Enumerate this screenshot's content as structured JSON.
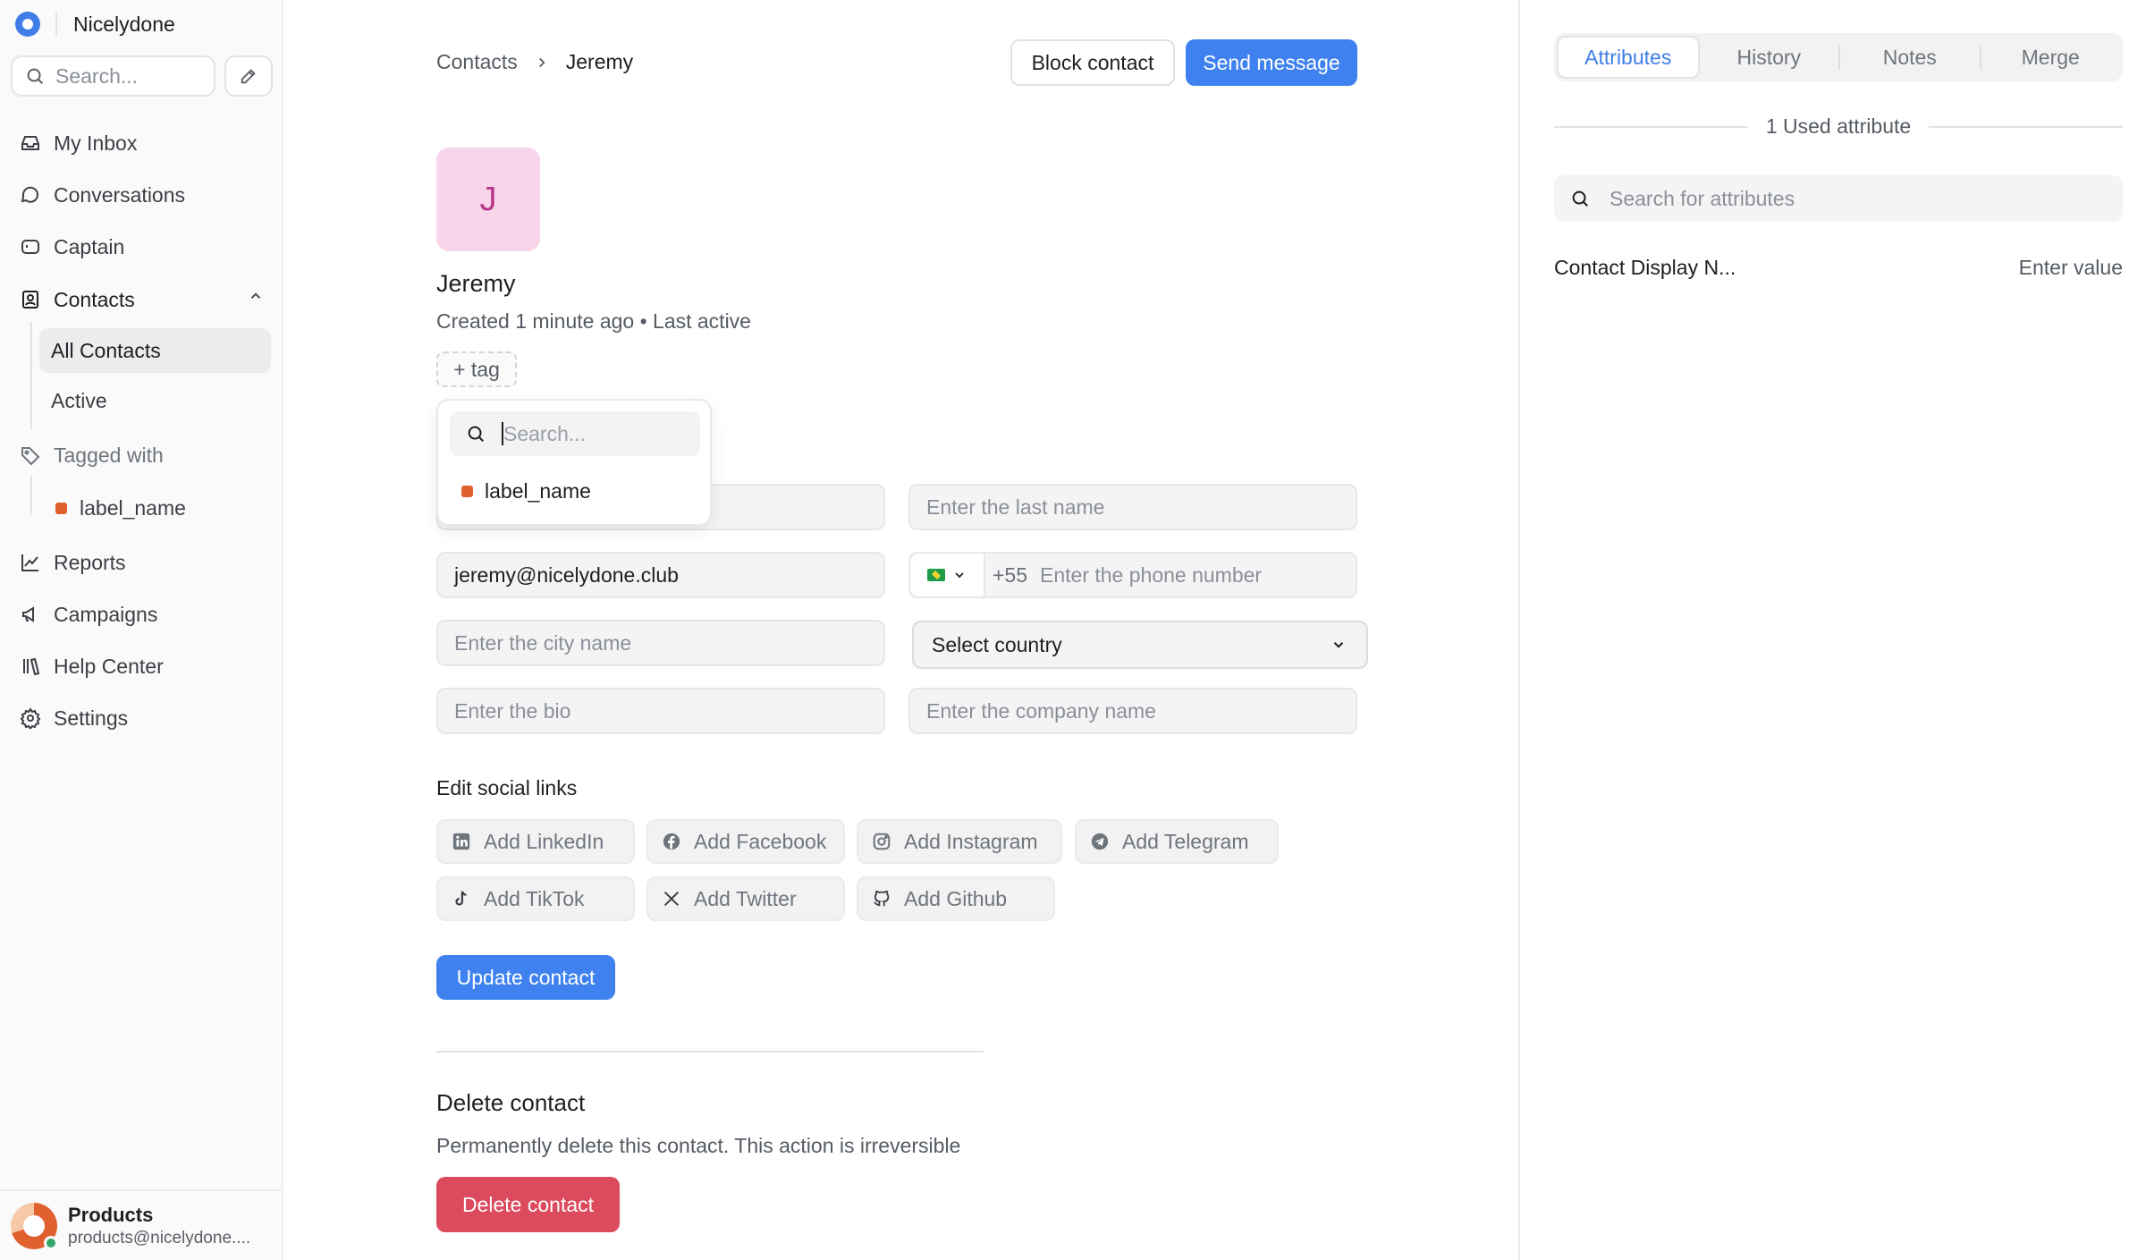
{
  "sidebar": {
    "brand": "Nicelydone",
    "search_placeholder": "Search...",
    "nav": {
      "my_inbox": "My Inbox",
      "conversations": "Conversations",
      "captain": "Captain",
      "contacts": "Contacts",
      "all_contacts": "All Contacts",
      "active": "Active",
      "tagged_with": "Tagged with",
      "label_name": "label_name",
      "reports": "Reports",
      "campaigns": "Campaigns",
      "help_center": "Help Center",
      "settings": "Settings"
    },
    "user": {
      "name": "Products",
      "email": "products@nicelydone...."
    }
  },
  "header": {
    "breadcrumb": [
      "Contacts",
      "Jeremy"
    ],
    "block_label": "Block contact",
    "send_label": "Send message"
  },
  "contact": {
    "initial": "J",
    "name": "Jeremy",
    "meta": "Created 1 minute ago • Last active",
    "tag_label": "+ tag",
    "tag_dropdown": {
      "search_placeholder": "Search...",
      "options": [
        "label_name"
      ]
    }
  },
  "form": {
    "last_name_placeholder": "Enter the last name",
    "email_value": "jeremy@nicelydone.club",
    "phone_code": "+55",
    "phone_placeholder": "Enter the phone number",
    "city_placeholder": "Enter the city name",
    "country_value": "Select country",
    "bio_placeholder": "Enter the bio",
    "company_placeholder": "Enter the company name"
  },
  "social": {
    "title": "Edit social links",
    "links": {
      "linkedin": "Add LinkedIn",
      "facebook": "Add Facebook",
      "instagram": "Add Instagram",
      "telegram": "Add Telegram",
      "tiktok": "Add TikTok",
      "twitter": "Add Twitter",
      "github": "Add Github"
    }
  },
  "update_label": "Update contact",
  "delete": {
    "title": "Delete contact",
    "description": "Permanently delete this contact. This action is irreversible",
    "button": "Delete contact"
  },
  "right_panel": {
    "tabs": [
      "Attributes",
      "History",
      "Notes",
      "Merge"
    ],
    "used_attributes": "1 Used attribute",
    "search_placeholder": "Search for attributes",
    "attribute_name": "Contact Display N...",
    "attribute_value": "Enter value"
  },
  "colors": {
    "primary": "#3f82ef",
    "danger": "#dc4a5d",
    "label": "#e0602f",
    "avatar_bg": "#f9d5ea"
  }
}
